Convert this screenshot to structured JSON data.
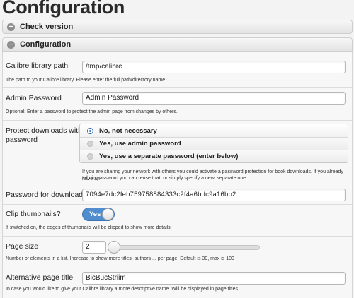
{
  "page": {
    "title": "Configuration"
  },
  "sections": {
    "check_version": {
      "label": "Check version",
      "icon": "plus-icon"
    },
    "configuration": {
      "label": "Configuration",
      "icon": "minus-icon"
    }
  },
  "fields": {
    "library_path": {
      "label": "Calibre library path",
      "value": "/tmp/calibre",
      "hint": "The path to your Calibre library. Please enter the full path/directory name."
    },
    "admin_password": {
      "label": "Admin Password",
      "value": "Admin Password",
      "hint": "Optional: Enter a password to protect the admin page from changes by others."
    },
    "protect_downloads": {
      "label_line1": "Protect downloads with a",
      "label_line2": "password",
      "options": [
        {
          "label": "No, not necessary",
          "selected": true
        },
        {
          "label": "Yes, use admin password",
          "selected": false
        },
        {
          "label": "Yes, use a separate password (enter below)",
          "selected": false
        }
      ],
      "hint_line1": "If you are sharing your network with others you could activate a password protection for book downloads. If you already have an",
      "hint_line2": "admin password you can reuse that, or simply specify a new, separate one."
    },
    "download_password": {
      "label": "Password for downloads",
      "value": "7094e7dc2feb759758884333c2f4a6bdc9a16bb2"
    },
    "clip_thumbnails": {
      "label": "Clip thumbnails?",
      "toggle_label": "Yes",
      "on": true,
      "hint": "If switched on, the edges of thumbnails will be clipped to show more details."
    },
    "page_size": {
      "label": "Page size",
      "value": "2",
      "slider_level": 0.0,
      "hint": "Number of elements in a list. Increase to show more titles, authors ... per page. Default is 30, max is 100"
    },
    "page_title": {
      "label": "Alternative page title",
      "value": "BicBucStriim",
      "hint": "In case you would like to give your Calibre library a more descriptive name. Will be displayed in page titles."
    }
  },
  "colors": {
    "accent": "#3b7ac5",
    "toggle_on": "#4f8dcf",
    "background": "#f3f3f3"
  }
}
